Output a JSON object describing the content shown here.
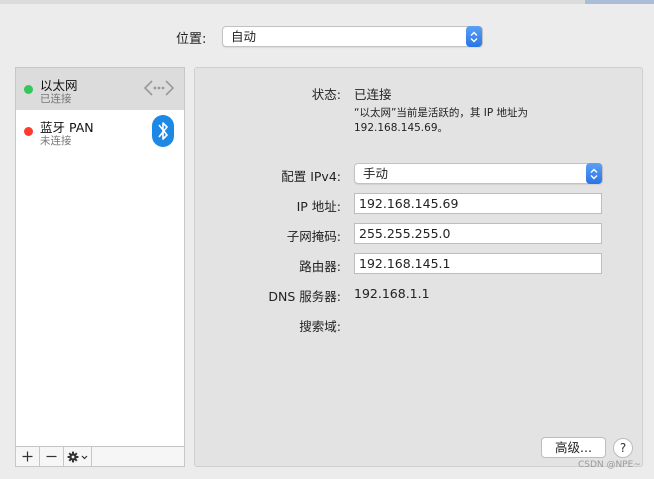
{
  "location": {
    "label": "位置:",
    "value": "自动"
  },
  "services": [
    {
      "name": "以太网",
      "status": "已连接",
      "status_color": "#34c759",
      "icon": "ethernet-arrows-icon"
    },
    {
      "name": "蓝牙 PAN",
      "status": "未连接",
      "status_color": "#ff3b30",
      "icon": "bluetooth-icon"
    }
  ],
  "toolbar": {
    "add": "+",
    "remove": "−",
    "gear": "gear-menu-icon"
  },
  "detail": {
    "status_label": "状态:",
    "status_value": "已连接",
    "status_desc": "“以太网”当前是活跃的，其 IP 地址为 192.168.145.69。",
    "config_label": "配置 IPv4:",
    "config_value": "手动",
    "ip_label": "IP 地址:",
    "ip_value": "192.168.145.69",
    "subnet_label": "子网掩码:",
    "subnet_value": "255.255.255.0",
    "router_label": "路由器:",
    "router_value": "192.168.145.1",
    "dns_label": "DNS 服务器:",
    "dns_value": "192.168.1.1",
    "search_label": "搜索域:"
  },
  "buttons": {
    "advanced": "高级...",
    "help": "?"
  },
  "watermark": "CSDN @NPE~",
  "colors": {
    "accent": "#2a74e6",
    "selected_row": "#dcdcdc",
    "bluetooth": "#1e88e5"
  }
}
